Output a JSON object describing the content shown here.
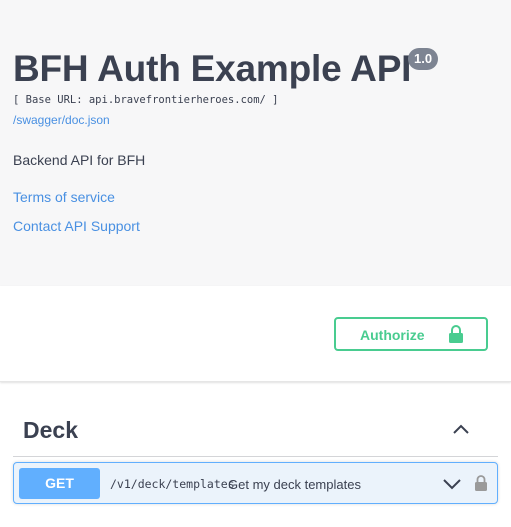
{
  "info": {
    "title": "BFH Auth Example API",
    "version": "1.0",
    "base_url": "[ Base URL: api.bravefrontierheroes.com/ ]",
    "spec_link": "/swagger/doc.json",
    "description": "Backend API for BFH",
    "terms_link": "Terms of service",
    "contact_link": "Contact API Support"
  },
  "scheme": {
    "authorize_label": "Authorize",
    "authorize_icon": "lock-icon"
  },
  "tags": [
    {
      "name": "Deck",
      "toggle_icon": "chevron-up-icon",
      "operations": [
        {
          "method": "GET",
          "path": "/v1/deck/templates",
          "summary": "Get my deck templates",
          "expand_icon": "chevron-down-icon",
          "auth_icon": "lock-icon"
        }
      ]
    }
  ],
  "colors": {
    "get": "#61affe",
    "get_bg": "#ebf3fb",
    "authorize": "#49cc90",
    "link": "#4990e2",
    "text": "#3b4151",
    "version_badge": "#7d8492"
  }
}
